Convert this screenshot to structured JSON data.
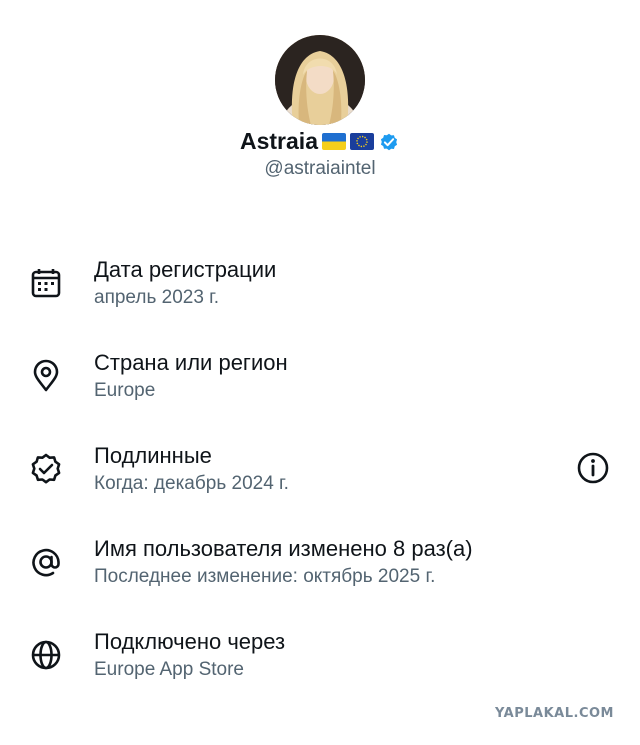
{
  "profile": {
    "name": "Astraia",
    "handle": "@astraiaintel",
    "flags": [
      "flag-ukraine-icon",
      "flag-eu-icon"
    ],
    "verified_icon": "verified-badge-icon"
  },
  "colors": {
    "text_primary": "#0f1419",
    "text_secondary": "#536471",
    "verified_blue": "#1d9bf0"
  },
  "rows": [
    {
      "icon": "calendar-icon",
      "title": "Дата регистрации",
      "subtitle": "апрель 2023 г."
    },
    {
      "icon": "location-pin-icon",
      "title": "Страна или регион",
      "subtitle": "Europe"
    },
    {
      "icon": "verified-outline-icon",
      "title": "Подлинные",
      "subtitle": "Когда: декабрь 2024 г."
    },
    {
      "icon": "at-sign-icon",
      "title": "Имя пользователя изменено 8 раз(а)",
      "subtitle": "Последнее изменение: октябрь 2025 г."
    },
    {
      "icon": "globe-icon",
      "title": "Подключено через",
      "subtitle": "Europe App Store"
    }
  ],
  "info_icon": "info-icon",
  "watermark": "YAPLAKAL.COM"
}
